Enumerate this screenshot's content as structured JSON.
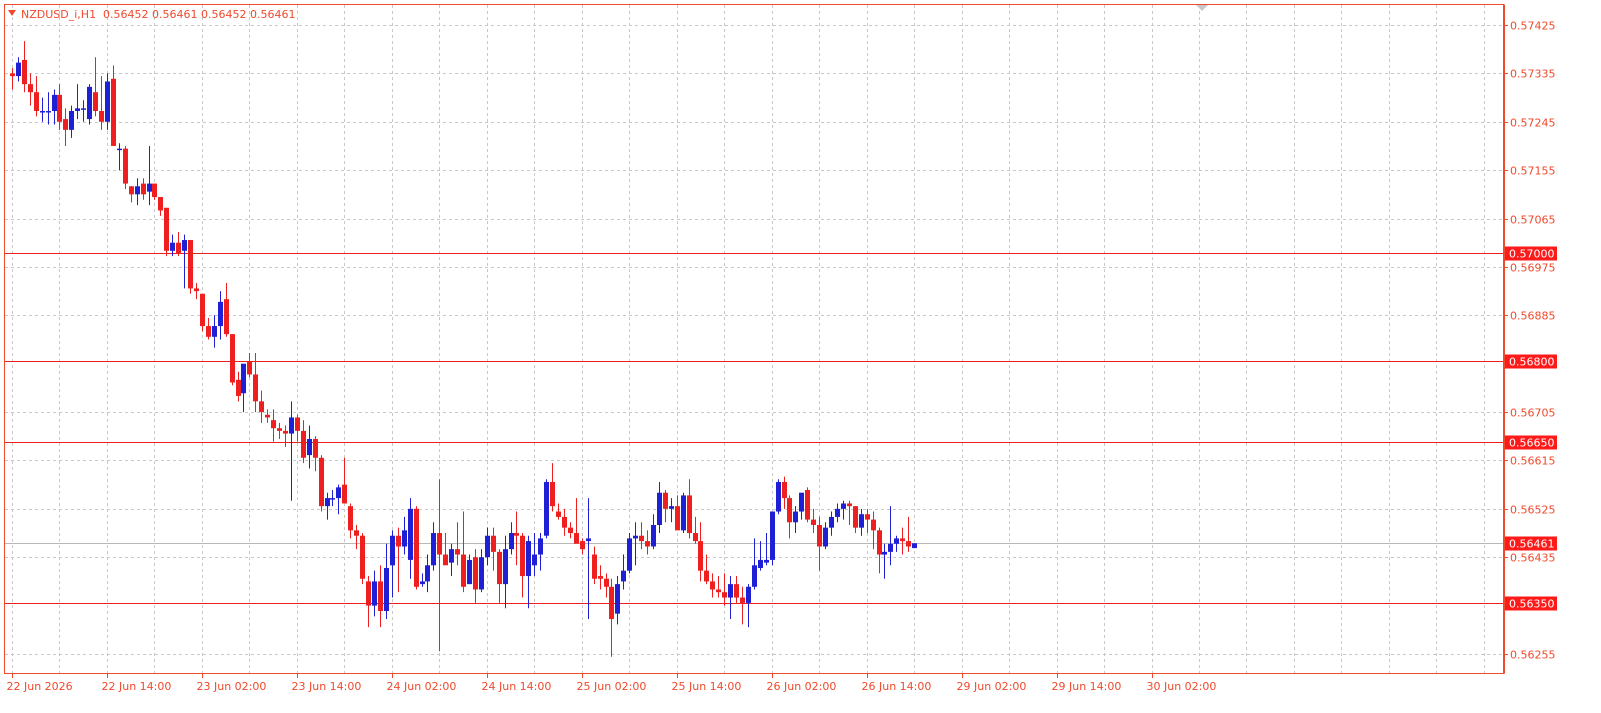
{
  "header": {
    "symbol": "NZDUSD_i,H1",
    "ohlc": "0.56452 0.56461 0.56452 0.56461"
  },
  "colors": {
    "background": "#ffffff",
    "frame": "#f04a2c",
    "grid": "#c8c8c8",
    "bull": "#1f1fd6",
    "bear": "#ef1f1f",
    "level_line": "#ef1f1f",
    "level_label_bg": "#ff1a1a",
    "level_label_text": "#ffffff",
    "bid_line": "#b8b8b8",
    "axis_text": "#f04a2c"
  },
  "icons": {
    "menu": "triangle-down-icon",
    "shift": "chart-shift-marker-icon"
  },
  "chart_data": {
    "type": "candlestick",
    "symbol": "NZDUSD_i",
    "timeframe": "H1",
    "ylim": [
      0.56215,
      0.57455
    ],
    "y_ticks": [
      "0.57425",
      "0.57335",
      "0.57245",
      "0.57155",
      "0.57065",
      "0.56975",
      "0.56885",
      "0.56705",
      "0.56615",
      "0.56525",
      "0.56435",
      "0.56255"
    ],
    "x_ticks": [
      "22 Jun 2026",
      "22 Jun 14:00",
      "23 Jun 02:00",
      "23 Jun 14:00",
      "24 Jun 02:00",
      "24 Jun 14:00",
      "25 Jun 02:00",
      "25 Jun 14:00",
      "26 Jun 02:00",
      "26 Jun 14:00",
      "29 Jun 02:00",
      "29 Jun 14:00",
      "30 Jun 02:00"
    ],
    "levels": [
      {
        "value": 0.57,
        "label": "0.57000"
      },
      {
        "value": 0.568,
        "label": "0.56800"
      },
      {
        "value": 0.5665,
        "label": "0.56650"
      },
      {
        "value": 0.5635,
        "label": "0.56350"
      }
    ],
    "current_price": {
      "value": 0.56461,
      "label": "0.56461"
    },
    "candles": [
      [
        0.57335,
        0.57345,
        0.57305,
        0.5733
      ],
      [
        0.5733,
        0.57365,
        0.5732,
        0.57355
      ],
      [
        0.5736,
        0.57395,
        0.573,
        0.57315
      ],
      [
        0.57315,
        0.57335,
        0.57275,
        0.573
      ],
      [
        0.573,
        0.5733,
        0.57255,
        0.57265
      ],
      [
        0.57265,
        0.5729,
        0.57245,
        0.57265
      ],
      [
        0.57265,
        0.573,
        0.5724,
        0.57265
      ],
      [
        0.57265,
        0.57305,
        0.5724,
        0.57295
      ],
      [
        0.57295,
        0.57315,
        0.5723,
        0.57245
      ],
      [
        0.5725,
        0.5727,
        0.572,
        0.5723
      ],
      [
        0.5723,
        0.57275,
        0.57215,
        0.57265
      ],
      [
        0.57265,
        0.57315,
        0.5725,
        0.5727
      ],
      [
        0.5727,
        0.57285,
        0.57245,
        0.5727
      ],
      [
        0.5725,
        0.57315,
        0.5724,
        0.5731
      ],
      [
        0.573,
        0.57365,
        0.57255,
        0.57265
      ],
      [
        0.57265,
        0.5733,
        0.5723,
        0.57245
      ],
      [
        0.57245,
        0.57335,
        0.5723,
        0.5732
      ],
      [
        0.57325,
        0.5735,
        0.57205,
        0.572
      ],
      [
        0.57195,
        0.57205,
        0.57155,
        0.57195
      ],
      [
        0.57195,
        0.572,
        0.5712,
        0.5713
      ],
      [
        0.57125,
        0.57125,
        0.57095,
        0.5711
      ],
      [
        0.5711,
        0.5714,
        0.5709,
        0.57125
      ],
      [
        0.5713,
        0.5714,
        0.571,
        0.5711
      ],
      [
        0.57115,
        0.572,
        0.5709,
        0.5713
      ],
      [
        0.5713,
        0.5713,
        0.571,
        0.57105
      ],
      [
        0.57105,
        0.57105,
        0.5707,
        0.5708
      ],
      [
        0.57085,
        0.57085,
        0.56995,
        0.57005
      ],
      [
        0.57005,
        0.57035,
        0.56995,
        0.5702
      ],
      [
        0.5702,
        0.5704,
        0.56995,
        0.57
      ],
      [
        0.57005,
        0.57035,
        0.56935,
        0.57025
      ],
      [
        0.57025,
        0.57025,
        0.56925,
        0.56935
      ],
      [
        0.56935,
        0.56945,
        0.56915,
        0.5693
      ],
      [
        0.56925,
        0.56925,
        0.56855,
        0.56865
      ],
      [
        0.56865,
        0.5688,
        0.5684,
        0.56845
      ],
      [
        0.56845,
        0.56885,
        0.56825,
        0.56865
      ],
      [
        0.56865,
        0.5693,
        0.5684,
        0.5691
      ],
      [
        0.56915,
        0.56945,
        0.56845,
        0.5685
      ],
      [
        0.5685,
        0.5685,
        0.56755,
        0.5676
      ],
      [
        0.56765,
        0.5678,
        0.56725,
        0.56735
      ],
      [
        0.5674,
        0.5679,
        0.56705,
        0.56795
      ],
      [
        0.568,
        0.56815,
        0.5677,
        0.56775
      ],
      [
        0.56775,
        0.56815,
        0.56705,
        0.56725
      ],
      [
        0.56725,
        0.56745,
        0.56685,
        0.56705
      ],
      [
        0.567,
        0.5671,
        0.56685,
        0.56695
      ],
      [
        0.5669,
        0.5671,
        0.5665,
        0.56675
      ],
      [
        0.56675,
        0.56685,
        0.56655,
        0.5667
      ],
      [
        0.5667,
        0.5668,
        0.5664,
        0.56665
      ],
      [
        0.56665,
        0.56725,
        0.5654,
        0.56695
      ],
      [
        0.56695,
        0.567,
        0.5665,
        0.5667
      ],
      [
        0.5667,
        0.5669,
        0.5661,
        0.5662
      ],
      [
        0.56625,
        0.5668,
        0.566,
        0.56655
      ],
      [
        0.56655,
        0.5666,
        0.56595,
        0.5662
      ],
      [
        0.5662,
        0.56625,
        0.5652,
        0.5653
      ],
      [
        0.5653,
        0.56555,
        0.56505,
        0.56545
      ],
      [
        0.56545,
        0.5656,
        0.5653,
        0.56545
      ],
      [
        0.56545,
        0.5657,
        0.56515,
        0.56565
      ],
      [
        0.5657,
        0.5662,
        0.56545,
        0.56535
      ],
      [
        0.5653,
        0.56535,
        0.5647,
        0.56485
      ],
      [
        0.56485,
        0.56495,
        0.5645,
        0.56475
      ],
      [
        0.56475,
        0.5648,
        0.56385,
        0.56395
      ],
      [
        0.5639,
        0.564,
        0.56305,
        0.56345
      ],
      [
        0.56345,
        0.5641,
        0.56325,
        0.5639
      ],
      [
        0.5639,
        0.5642,
        0.56305,
        0.56335
      ],
      [
        0.56335,
        0.5646,
        0.5632,
        0.56415
      ],
      [
        0.5642,
        0.56485,
        0.5636,
        0.56475
      ],
      [
        0.56475,
        0.5649,
        0.5637,
        0.56455
      ],
      [
        0.56455,
        0.5651,
        0.5644,
        0.56485
      ],
      [
        0.5643,
        0.56545,
        0.56395,
        0.56525
      ],
      [
        0.56525,
        0.5653,
        0.56375,
        0.5638
      ],
      [
        0.56385,
        0.56405,
        0.5638,
        0.5639
      ],
      [
        0.5639,
        0.5644,
        0.5637,
        0.5642
      ],
      [
        0.5642,
        0.565,
        0.5641,
        0.5648
      ],
      [
        0.5648,
        0.5658,
        0.5626,
        0.5644
      ],
      [
        0.5644,
        0.5648,
        0.56425,
        0.5642
      ],
      [
        0.56425,
        0.5646,
        0.564,
        0.5645
      ],
      [
        0.5645,
        0.565,
        0.5642,
        0.5644
      ],
      [
        0.5644,
        0.5652,
        0.5637,
        0.5638
      ],
      [
        0.56385,
        0.5644,
        0.56385,
        0.5643
      ],
      [
        0.56435,
        0.5645,
        0.5635,
        0.56375
      ],
      [
        0.56375,
        0.5645,
        0.5637,
        0.56435
      ],
      [
        0.56435,
        0.5649,
        0.5642,
        0.56475
      ],
      [
        0.56475,
        0.5649,
        0.5641,
        0.56445
      ],
      [
        0.56445,
        0.5645,
        0.5635,
        0.56385
      ],
      [
        0.56385,
        0.56475,
        0.5634,
        0.5645
      ],
      [
        0.5645,
        0.565,
        0.5644,
        0.5648
      ],
      [
        0.5648,
        0.5652,
        0.5642,
        0.56475
      ],
      [
        0.56475,
        0.5648,
        0.5636,
        0.564
      ],
      [
        0.564,
        0.56475,
        0.5634,
        0.56465
      ],
      [
        0.5642,
        0.5648,
        0.564,
        0.5644
      ],
      [
        0.5644,
        0.5648,
        0.5641,
        0.5647
      ],
      [
        0.56475,
        0.5658,
        0.5647,
        0.56575
      ],
      [
        0.56575,
        0.5661,
        0.5652,
        0.5653
      ],
      [
        0.5652,
        0.56535,
        0.56505,
        0.5651
      ],
      [
        0.5651,
        0.56525,
        0.56475,
        0.5649
      ],
      [
        0.5649,
        0.565,
        0.5647,
        0.5648
      ],
      [
        0.5648,
        0.56545,
        0.56465,
        0.5646
      ],
      [
        0.56465,
        0.5647,
        0.5644,
        0.5645
      ],
      [
        0.56465,
        0.56545,
        0.5632,
        0.5647
      ],
      [
        0.5644,
        0.56455,
        0.56385,
        0.56395
      ],
      [
        0.564,
        0.5642,
        0.56375,
        0.56395
      ],
      [
        0.56395,
        0.56405,
        0.5636,
        0.5638
      ],
      [
        0.5638,
        0.56395,
        0.5625,
        0.5632
      ],
      [
        0.5633,
        0.564,
        0.5631,
        0.56385
      ],
      [
        0.5639,
        0.5644,
        0.56375,
        0.5641
      ],
      [
        0.5641,
        0.5648,
        0.56405,
        0.5647
      ],
      [
        0.5647,
        0.565,
        0.5642,
        0.56475
      ],
      [
        0.56475,
        0.565,
        0.5645,
        0.56465
      ],
      [
        0.56465,
        0.56485,
        0.5644,
        0.56455
      ],
      [
        0.56455,
        0.56515,
        0.5645,
        0.56495
      ],
      [
        0.56495,
        0.56575,
        0.5648,
        0.56555
      ],
      [
        0.56555,
        0.5656,
        0.565,
        0.56525
      ],
      [
        0.56525,
        0.56545,
        0.565,
        0.5653
      ],
      [
        0.5653,
        0.5655,
        0.5649,
        0.56485
      ],
      [
        0.56485,
        0.56555,
        0.5648,
        0.5655
      ],
      [
        0.5655,
        0.5658,
        0.5647,
        0.5648
      ],
      [
        0.5648,
        0.5651,
        0.5646,
        0.56465
      ],
      [
        0.56465,
        0.565,
        0.5639,
        0.5641
      ],
      [
        0.5641,
        0.5644,
        0.56385,
        0.5639
      ],
      [
        0.5639,
        0.56405,
        0.5636,
        0.56375
      ],
      [
        0.56375,
        0.564,
        0.5636,
        0.5637
      ],
      [
        0.5637,
        0.56405,
        0.56345,
        0.5636
      ],
      [
        0.5636,
        0.564,
        0.5632,
        0.56385
      ],
      [
        0.56385,
        0.564,
        0.5635,
        0.5636
      ],
      [
        0.5636,
        0.5638,
        0.5631,
        0.5635
      ],
      [
        0.5635,
        0.56385,
        0.56305,
        0.5638
      ],
      [
        0.5638,
        0.5647,
        0.56375,
        0.5642
      ],
      [
        0.56415,
        0.56465,
        0.5641,
        0.5643
      ],
      [
        0.56425,
        0.5648,
        0.5642,
        0.5643
      ],
      [
        0.5643,
        0.5652,
        0.5642,
        0.5652
      ],
      [
        0.5652,
        0.5658,
        0.56515,
        0.56575
      ],
      [
        0.56575,
        0.56585,
        0.56525,
        0.56545
      ],
      [
        0.56545,
        0.5655,
        0.5647,
        0.565
      ],
      [
        0.565,
        0.5653,
        0.5648,
        0.5652
      ],
      [
        0.5652,
        0.56555,
        0.56505,
        0.56555
      ],
      [
        0.5656,
        0.56565,
        0.565,
        0.56505
      ],
      [
        0.56505,
        0.56525,
        0.5648,
        0.56495
      ],
      [
        0.56495,
        0.5651,
        0.5641,
        0.56455
      ],
      [
        0.56455,
        0.565,
        0.5645,
        0.5649
      ],
      [
        0.5649,
        0.5652,
        0.56475,
        0.5651
      ],
      [
        0.5651,
        0.56535,
        0.565,
        0.56525
      ],
      [
        0.56525,
        0.5654,
        0.56505,
        0.56535
      ],
      [
        0.56535,
        0.5654,
        0.56495,
        0.5653
      ],
      [
        0.5653,
        0.5653,
        0.5648,
        0.5649
      ],
      [
        0.5649,
        0.56525,
        0.56475,
        0.56515
      ],
      [
        0.56515,
        0.56525,
        0.5648,
        0.56505
      ],
      [
        0.56505,
        0.5652,
        0.5645,
        0.56485
      ],
      [
        0.56485,
        0.5649,
        0.56405,
        0.5644
      ],
      [
        0.5644,
        0.5646,
        0.56395,
        0.56445
      ],
      [
        0.56445,
        0.5653,
        0.5642,
        0.5646
      ],
      [
        0.5646,
        0.56475,
        0.56445,
        0.5647
      ],
      [
        0.5647,
        0.5649,
        0.5644,
        0.56465
      ],
      [
        0.56465,
        0.5651,
        0.56445,
        0.56455
      ],
      [
        0.56452,
        0.56461,
        0.56452,
        0.56461
      ]
    ]
  }
}
